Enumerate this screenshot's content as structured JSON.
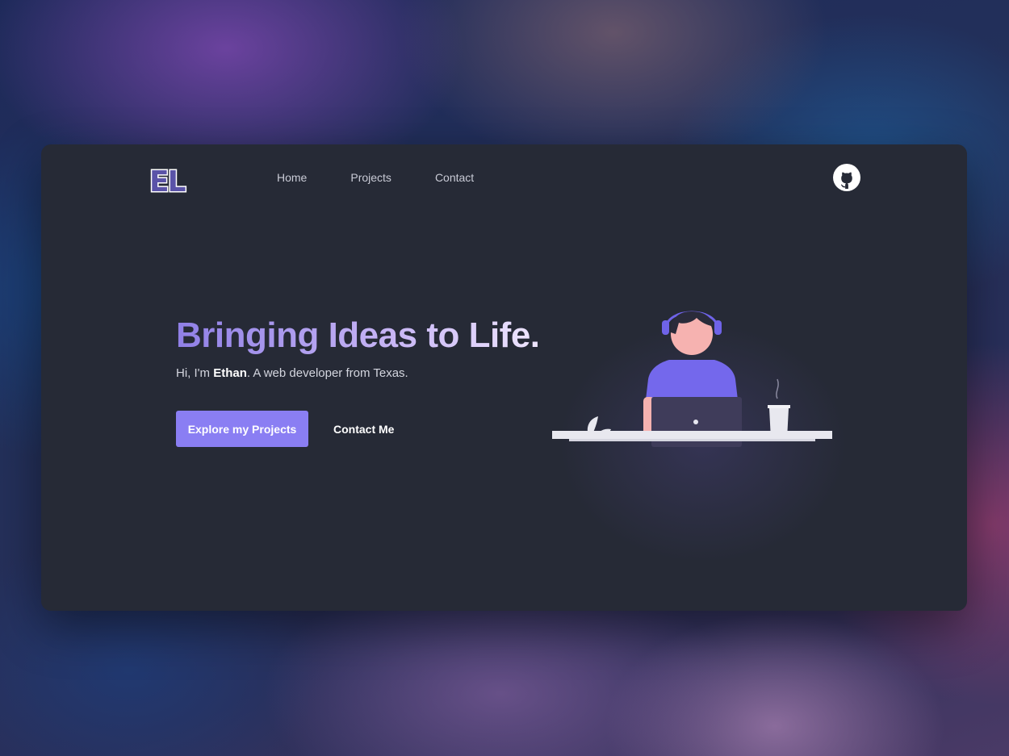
{
  "nav": {
    "logo_text": "EL",
    "links": [
      {
        "label": "Home"
      },
      {
        "label": "Projects"
      },
      {
        "label": "Contact"
      }
    ],
    "github_icon": "github-icon"
  },
  "hero": {
    "title": "Bringing Ideas to Life.",
    "subtitle_prefix": "Hi, I'm ",
    "subtitle_name": "Ethan",
    "subtitle_suffix": ". A web developer from Texas.",
    "primary_button": "Explore my Projects",
    "secondary_button": "Contact Me"
  },
  "colors": {
    "accent": "#8a7ef3",
    "card_bg": "#262a36",
    "text_muted": "#c9cbd6"
  },
  "illustration": "developer-at-desk-illustration"
}
